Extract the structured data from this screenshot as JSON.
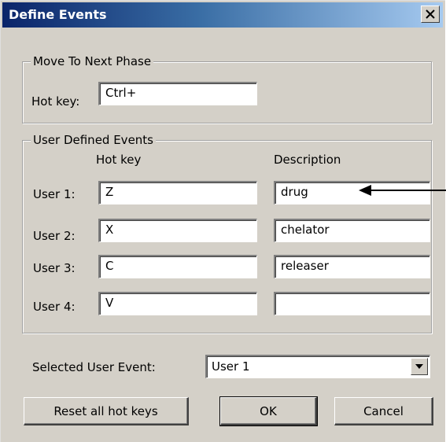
{
  "window": {
    "title": "Define Events"
  },
  "move_phase": {
    "caption": "Move To Next Phase",
    "hotkey_label": "Hot key:",
    "hotkey_value": "Ctrl+"
  },
  "user_events": {
    "caption": "User Defined Events",
    "col_hotkey": "Hot key",
    "col_description": "Description",
    "rows": [
      {
        "label": "User 1:",
        "hotkey": "Z",
        "description": "drug"
      },
      {
        "label": "User 2:",
        "hotkey": "X",
        "description": "chelator"
      },
      {
        "label": "User 3:",
        "hotkey": "C",
        "description": "releaser"
      },
      {
        "label": "User 4:",
        "hotkey": "V",
        "description": ""
      }
    ]
  },
  "selected_event": {
    "label": "Selected User Event:",
    "value": "User 1"
  },
  "buttons": {
    "reset": "Reset all hot keys",
    "ok": "OK",
    "cancel": "Cancel"
  },
  "icons": {
    "close": "close-icon",
    "dropdown": "chevron-down-icon",
    "annotation": "arrow-left-icon"
  }
}
